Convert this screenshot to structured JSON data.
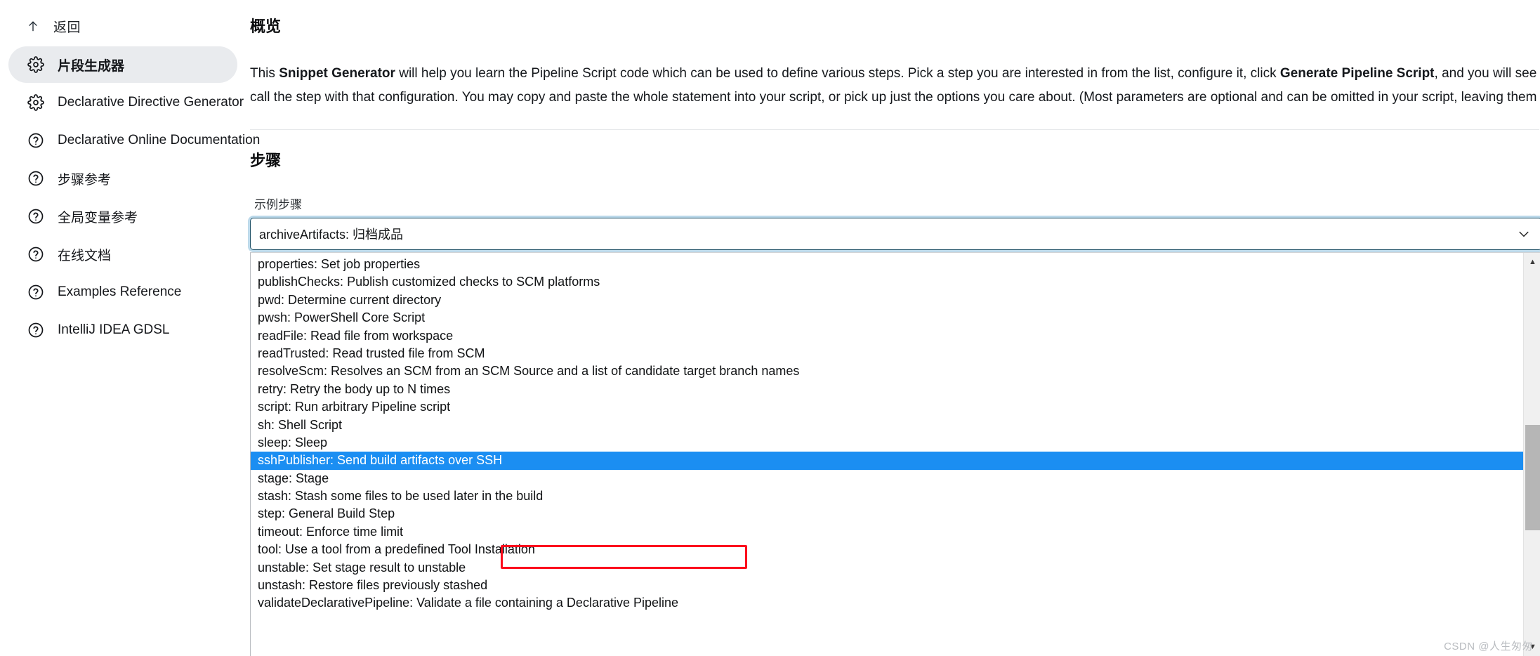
{
  "sidebar": {
    "back": {
      "label": "返回",
      "icon": "arrow-up-icon"
    },
    "items": [
      {
        "label": "片段生成器",
        "icon": "gear-icon",
        "active": true
      },
      {
        "label": "Declarative Directive Generator",
        "icon": "gear-icon",
        "active": false
      },
      {
        "label": "Declarative Online Documentation",
        "icon": "help-circle-icon",
        "active": false
      },
      {
        "label": "步骤参考",
        "icon": "help-circle-icon",
        "active": false
      },
      {
        "label": "全局变量参考",
        "icon": "help-circle-icon",
        "active": false
      },
      {
        "label": "在线文档",
        "icon": "help-circle-icon",
        "active": false
      },
      {
        "label": "Examples Reference",
        "icon": "help-circle-icon",
        "active": false
      },
      {
        "label": "IntelliJ IDEA GDSL",
        "icon": "help-circle-icon",
        "active": false
      }
    ]
  },
  "main": {
    "overview_title": "概览",
    "overview_paragraph_parts": {
      "p1": "This ",
      "b1": "Snippet Generator",
      "p2": " will help you learn the Pipeline Script code which can be used to define various steps. Pick a step you are interested in from the list, configure it, click ",
      "b2": "Generate Pipeline Script",
      "p3": ", and you will see a Pipeline Script statement that would call the step with that configuration. You may copy and paste the whole statement into your script, or pick up just the options you care about. (Most parameters are optional and can be omitted in your script, leaving them at default values.)"
    },
    "steps_title": "步骤",
    "sample_step_label": "示例步骤",
    "combobox": {
      "value": "archiveArtifacts: 归档成品",
      "chevron_icon": "chevron-down-icon",
      "expanded": true
    },
    "dropdown": {
      "selected_index": 10,
      "scrollbar": {
        "up_icon": "scroll-up-arrow-icon",
        "down_icon": "scroll-down-arrow-icon"
      },
      "options": [
        "properties: Set job properties",
        "publishChecks: Publish customized checks to SCM platforms",
        "pwd: Determine current directory",
        "pwsh: PowerShell Core Script",
        "readFile: Read file from workspace",
        "readTrusted: Read trusted file from SCM",
        "resolveScm: Resolves an SCM from an SCM Source and a list of candidate target branch names",
        "retry: Retry the body up to N times",
        "script: Run arbitrary Pipeline script",
        "sh: Shell Script",
        "sleep: Sleep",
        "sshPublisher: Send build artifacts over SSH",
        "stage: Stage",
        "stash: Stash some files to be used later in the build",
        "step: General Build Step",
        "timeout: Enforce time limit",
        "tool: Use a tool from a predefined Tool Installation",
        "unstable: Set stage result to unstable",
        "unstash: Restore files previously stashed",
        "validateDeclarativePipeline: Validate a file containing a Declarative Pipeline"
      ]
    }
  },
  "annotation": {
    "highlight_color": "#fc0d1c",
    "selection_color": "#1b8ef2"
  },
  "watermark": {
    "text": "CSDN @人生匆匆"
  }
}
